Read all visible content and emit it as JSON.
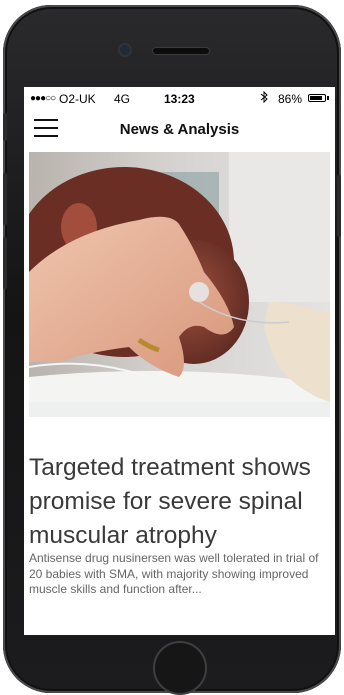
{
  "status_bar": {
    "signal": "●●●○○",
    "carrier": "O2-UK",
    "network": "4G",
    "time": "13:23",
    "bluetooth_icon": "bluetooth-icon",
    "battery_percent": "86%",
    "battery_level": 0.86
  },
  "header": {
    "menu_icon": "hamburger-menu-icon",
    "title": "News & Analysis"
  },
  "article": {
    "image": "newborn baby with electrodes, adult hand resting on head",
    "headline": "Targeted treatment shows promise for severe spinal muscular atrophy",
    "summary": "Antisense drug nusinersen was well tolerated in trial of 20 babies with SMA, with majority showing improved muscle skills and function after..."
  },
  "colors": {
    "phone_body": "#1c1c1e",
    "headline": "#3a3a3a",
    "summary": "#666666"
  }
}
